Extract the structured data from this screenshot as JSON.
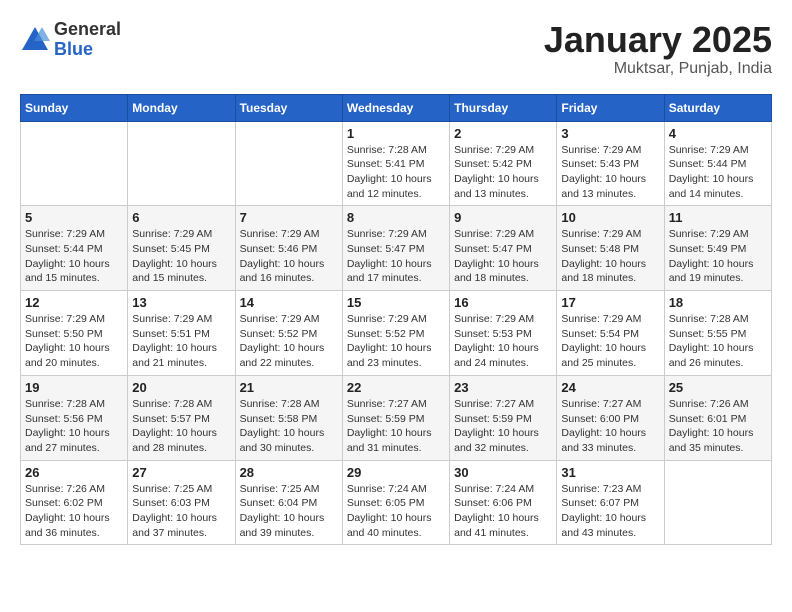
{
  "header": {
    "logo_general": "General",
    "logo_blue": "Blue",
    "title": "January 2025",
    "subtitle": "Muktsar, Punjab, India"
  },
  "days_of_week": [
    "Sunday",
    "Monday",
    "Tuesday",
    "Wednesday",
    "Thursday",
    "Friday",
    "Saturday"
  ],
  "weeks": [
    {
      "days": [
        {
          "num": "",
          "info": ""
        },
        {
          "num": "",
          "info": ""
        },
        {
          "num": "",
          "info": ""
        },
        {
          "num": "1",
          "info": "Sunrise: 7:28 AM\nSunset: 5:41 PM\nDaylight: 10 hours\nand 12 minutes."
        },
        {
          "num": "2",
          "info": "Sunrise: 7:29 AM\nSunset: 5:42 PM\nDaylight: 10 hours\nand 13 minutes."
        },
        {
          "num": "3",
          "info": "Sunrise: 7:29 AM\nSunset: 5:43 PM\nDaylight: 10 hours\nand 13 minutes."
        },
        {
          "num": "4",
          "info": "Sunrise: 7:29 AM\nSunset: 5:44 PM\nDaylight: 10 hours\nand 14 minutes."
        }
      ]
    },
    {
      "days": [
        {
          "num": "5",
          "info": "Sunrise: 7:29 AM\nSunset: 5:44 PM\nDaylight: 10 hours\nand 15 minutes."
        },
        {
          "num": "6",
          "info": "Sunrise: 7:29 AM\nSunset: 5:45 PM\nDaylight: 10 hours\nand 15 minutes."
        },
        {
          "num": "7",
          "info": "Sunrise: 7:29 AM\nSunset: 5:46 PM\nDaylight: 10 hours\nand 16 minutes."
        },
        {
          "num": "8",
          "info": "Sunrise: 7:29 AM\nSunset: 5:47 PM\nDaylight: 10 hours\nand 17 minutes."
        },
        {
          "num": "9",
          "info": "Sunrise: 7:29 AM\nSunset: 5:47 PM\nDaylight: 10 hours\nand 18 minutes."
        },
        {
          "num": "10",
          "info": "Sunrise: 7:29 AM\nSunset: 5:48 PM\nDaylight: 10 hours\nand 18 minutes."
        },
        {
          "num": "11",
          "info": "Sunrise: 7:29 AM\nSunset: 5:49 PM\nDaylight: 10 hours\nand 19 minutes."
        }
      ]
    },
    {
      "days": [
        {
          "num": "12",
          "info": "Sunrise: 7:29 AM\nSunset: 5:50 PM\nDaylight: 10 hours\nand 20 minutes."
        },
        {
          "num": "13",
          "info": "Sunrise: 7:29 AM\nSunset: 5:51 PM\nDaylight: 10 hours\nand 21 minutes."
        },
        {
          "num": "14",
          "info": "Sunrise: 7:29 AM\nSunset: 5:52 PM\nDaylight: 10 hours\nand 22 minutes."
        },
        {
          "num": "15",
          "info": "Sunrise: 7:29 AM\nSunset: 5:52 PM\nDaylight: 10 hours\nand 23 minutes."
        },
        {
          "num": "16",
          "info": "Sunrise: 7:29 AM\nSunset: 5:53 PM\nDaylight: 10 hours\nand 24 minutes."
        },
        {
          "num": "17",
          "info": "Sunrise: 7:29 AM\nSunset: 5:54 PM\nDaylight: 10 hours\nand 25 minutes."
        },
        {
          "num": "18",
          "info": "Sunrise: 7:28 AM\nSunset: 5:55 PM\nDaylight: 10 hours\nand 26 minutes."
        }
      ]
    },
    {
      "days": [
        {
          "num": "19",
          "info": "Sunrise: 7:28 AM\nSunset: 5:56 PM\nDaylight: 10 hours\nand 27 minutes."
        },
        {
          "num": "20",
          "info": "Sunrise: 7:28 AM\nSunset: 5:57 PM\nDaylight: 10 hours\nand 28 minutes."
        },
        {
          "num": "21",
          "info": "Sunrise: 7:28 AM\nSunset: 5:58 PM\nDaylight: 10 hours\nand 30 minutes."
        },
        {
          "num": "22",
          "info": "Sunrise: 7:27 AM\nSunset: 5:59 PM\nDaylight: 10 hours\nand 31 minutes."
        },
        {
          "num": "23",
          "info": "Sunrise: 7:27 AM\nSunset: 5:59 PM\nDaylight: 10 hours\nand 32 minutes."
        },
        {
          "num": "24",
          "info": "Sunrise: 7:27 AM\nSunset: 6:00 PM\nDaylight: 10 hours\nand 33 minutes."
        },
        {
          "num": "25",
          "info": "Sunrise: 7:26 AM\nSunset: 6:01 PM\nDaylight: 10 hours\nand 35 minutes."
        }
      ]
    },
    {
      "days": [
        {
          "num": "26",
          "info": "Sunrise: 7:26 AM\nSunset: 6:02 PM\nDaylight: 10 hours\nand 36 minutes."
        },
        {
          "num": "27",
          "info": "Sunrise: 7:25 AM\nSunset: 6:03 PM\nDaylight: 10 hours\nand 37 minutes."
        },
        {
          "num": "28",
          "info": "Sunrise: 7:25 AM\nSunset: 6:04 PM\nDaylight: 10 hours\nand 39 minutes."
        },
        {
          "num": "29",
          "info": "Sunrise: 7:24 AM\nSunset: 6:05 PM\nDaylight: 10 hours\nand 40 minutes."
        },
        {
          "num": "30",
          "info": "Sunrise: 7:24 AM\nSunset: 6:06 PM\nDaylight: 10 hours\nand 41 minutes."
        },
        {
          "num": "31",
          "info": "Sunrise: 7:23 AM\nSunset: 6:07 PM\nDaylight: 10 hours\nand 43 minutes."
        },
        {
          "num": "",
          "info": ""
        }
      ]
    }
  ]
}
